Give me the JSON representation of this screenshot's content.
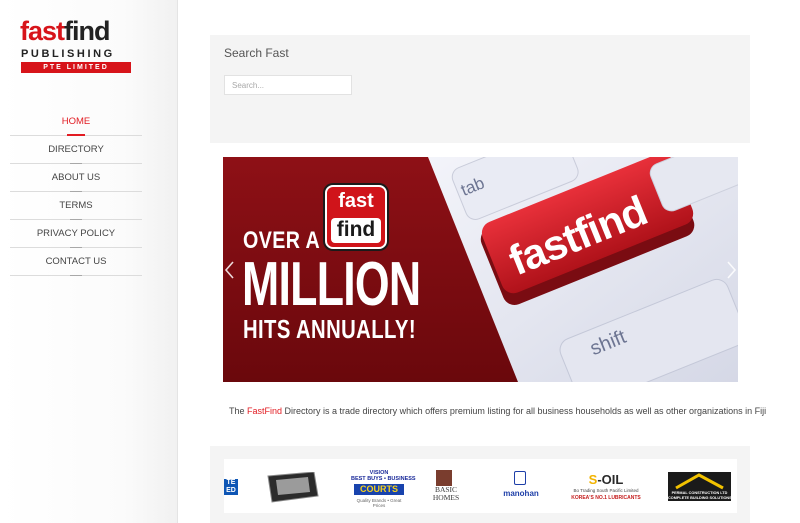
{
  "brand": {
    "word_part1": "fast",
    "word_part2": "find",
    "line2": "PUBLISHING",
    "line3": "PTE LIMITED",
    "accent_color": "#d7141a"
  },
  "nav": {
    "items": [
      {
        "label": "HOME",
        "active": true
      },
      {
        "label": "DIRECTORY",
        "active": false
      },
      {
        "label": "ABOUT US",
        "active": false
      },
      {
        "label": "TERMS",
        "active": false
      },
      {
        "label": "PRIVACY POLICY",
        "active": false
      },
      {
        "label": "CONTACT US",
        "active": false
      }
    ]
  },
  "search": {
    "title": "Search Fast",
    "placeholder": "Search..."
  },
  "slider": {
    "badge_top": "fast",
    "badge_bottom": "find",
    "headline_1": "OVER A",
    "headline_2": "MILLION",
    "headline_3": "HITS ANNUALLY!",
    "key_tab": "tab",
    "key_main": "fastfind",
    "key_shift": "shift",
    "prev_icon": "chevron-left-icon",
    "next_icon": "chevron-right-icon"
  },
  "tagline": {
    "prefix": "The ",
    "brand": "FastFind",
    "suffix": " Directory is a trade directory which offers premium listing for all business households as well as other organizations in Fiji"
  },
  "partners": {
    "ted": "TE\nED",
    "courts_top": "VISION\nBEST BUYS • BUSINESS",
    "courts_name": "COURTS",
    "courts_sub": "Quality Brands • Great Prices",
    "basic": "BASIC\nHOMES",
    "manohan": "manohan",
    "soil_s": "S",
    "soil_rest": "-OIL",
    "soil_sub": "Bo Trading South Pacific Limited",
    "soil_sub2": "KOREA'S NO.1 LUBRICANTS",
    "pc_text": "PERMAL CONSTRUCTION LTD\nCOMPLETE BUILDING SOLUTIONS"
  }
}
